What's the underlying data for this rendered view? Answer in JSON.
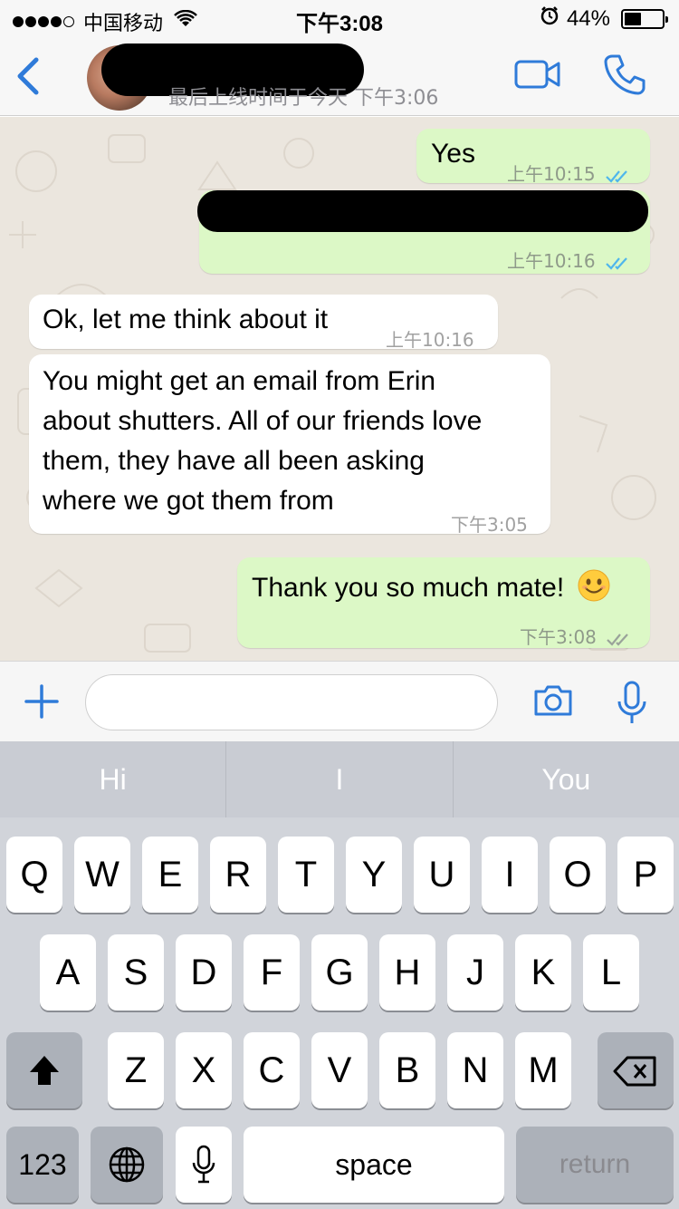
{
  "status_bar": {
    "carrier": "中国移动",
    "time": "下午3:08",
    "battery_percent": "44%",
    "battery_level": 0.44
  },
  "header": {
    "last_seen": "最后上线时间于今天 下午3:06"
  },
  "messages": [
    {
      "direction": "outgoing",
      "text": "Yes",
      "time": "上午10:15",
      "status": "read"
    },
    {
      "direction": "outgoing",
      "text": "",
      "redacted": true,
      "time": "上午10:16",
      "status": "read"
    },
    {
      "direction": "incoming",
      "text": "Ok, let me think about it",
      "time": "上午10:16"
    },
    {
      "direction": "incoming",
      "lines": [
        "You might get an email from Erin",
        "about shutters. All of our friends love",
        "them, they have all been asking",
        "where we got them from"
      ],
      "time": "下午3:05"
    },
    {
      "direction": "outgoing",
      "text": "Thank you so much mate!",
      "time": "下午3:08",
      "status": "delivered"
    }
  ],
  "composer": {
    "value": "",
    "placeholder": ""
  },
  "predictive": [
    "Hi",
    "I",
    "You"
  ],
  "keyboard": {
    "row1": [
      "Q",
      "W",
      "E",
      "R",
      "T",
      "Y",
      "U",
      "I",
      "O",
      "P"
    ],
    "row2": [
      "A",
      "S",
      "D",
      "F",
      "G",
      "H",
      "J",
      "K",
      "L"
    ],
    "row3": [
      "Z",
      "X",
      "C",
      "V",
      "B",
      "N",
      "M"
    ],
    "numbers": "123",
    "space": "space",
    "return": "return"
  },
  "colors": {
    "accent": "#2f7bd9",
    "outgoing_bubble": "#dcf8c6",
    "incoming_bubble": "#ffffff",
    "chat_background": "#ebe6de",
    "read_tick": "#4fb6ec",
    "keyboard_bg": "#d1d4da"
  }
}
